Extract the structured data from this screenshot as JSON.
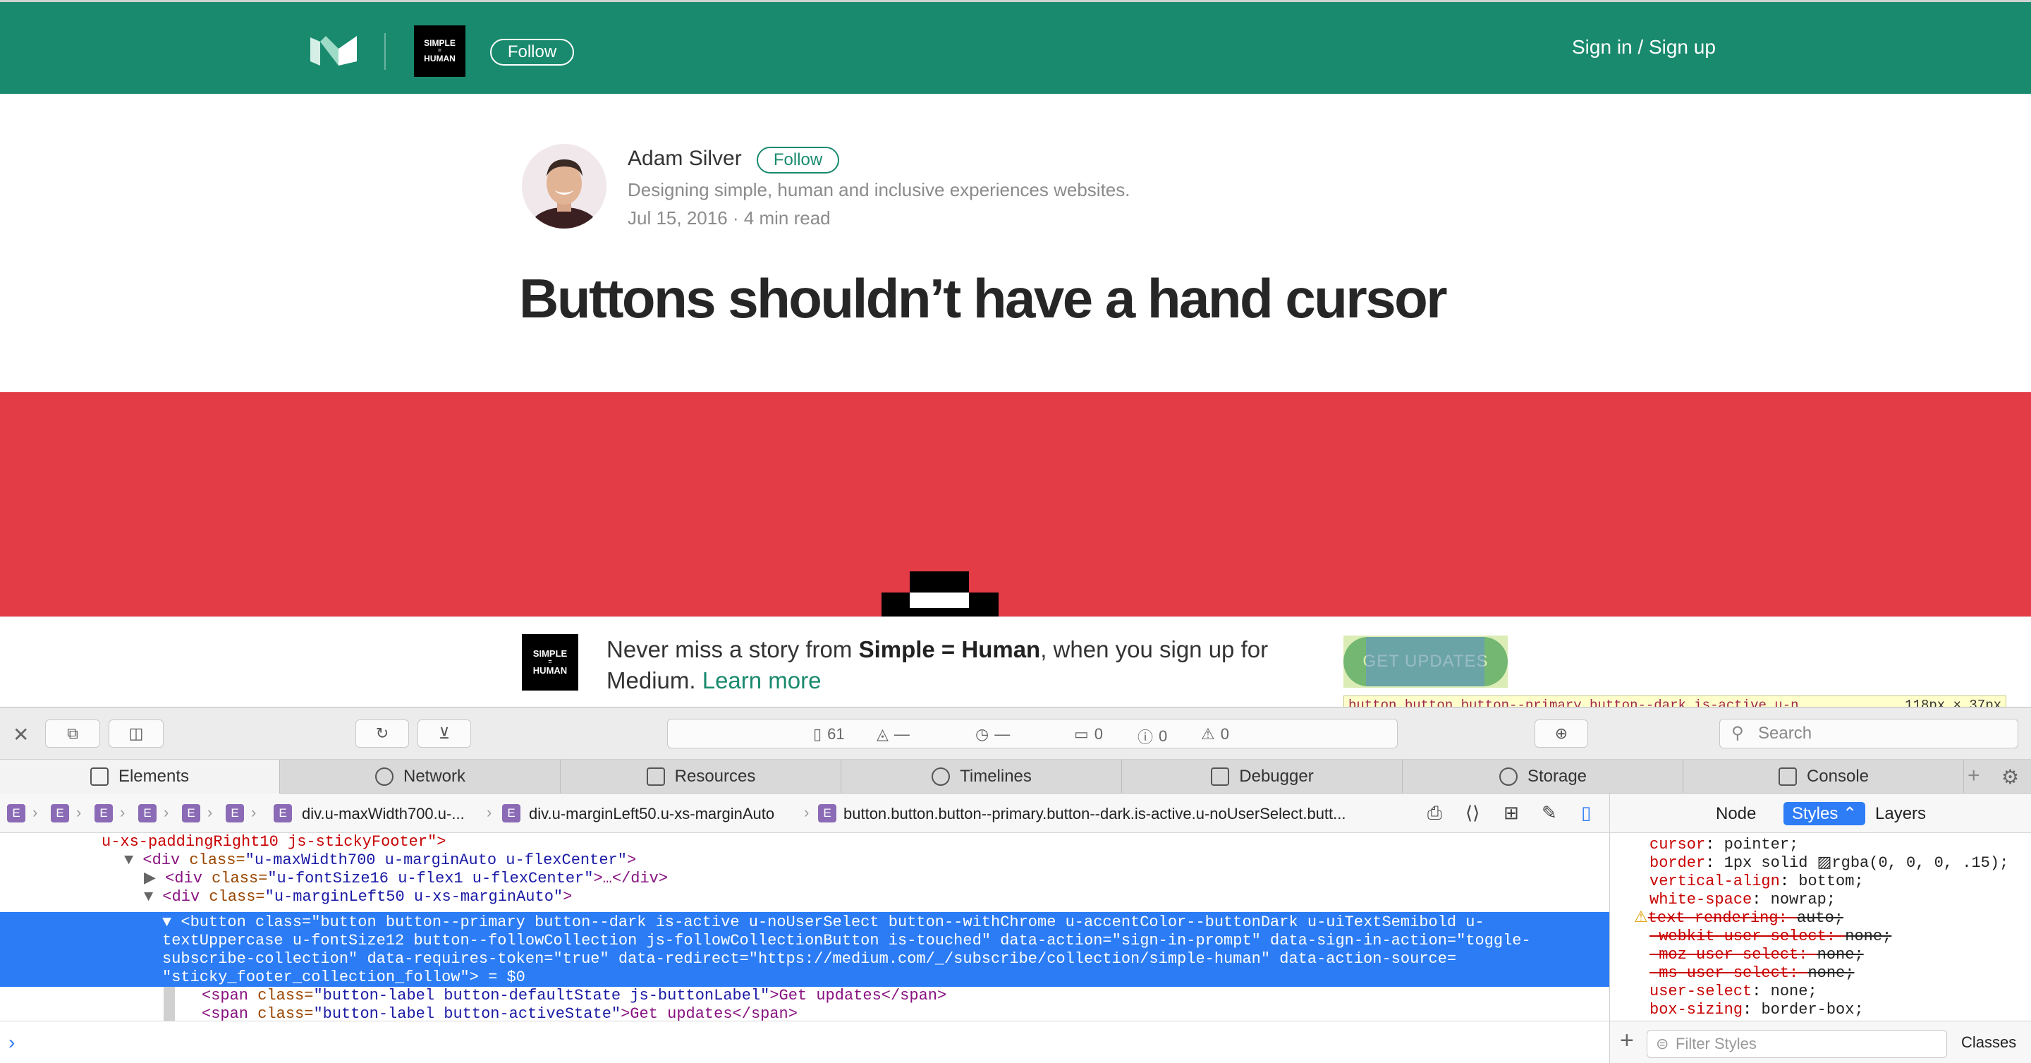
{
  "header": {
    "follow_label": "Follow",
    "signin_label": "Sign in / Sign up",
    "pub_logo_line1": "SIMPLE",
    "pub_logo_line2": "=",
    "pub_logo_line3": "HUMAN"
  },
  "author": {
    "name": "Adam Silver",
    "follow_label": "Follow",
    "bio": "Designing simple, human and inclusive experiences websites.",
    "meta": "Jul 15, 2016 · 4 min read"
  },
  "post": {
    "title": "Buttons shouldn’t have a hand cursor"
  },
  "sticky_footer": {
    "text_before": "Never miss a story from ",
    "pub_name": "Simple = Human",
    "text_after": ", when you sign up for Medium. ",
    "learn_more": "Learn more",
    "button_label": "Get updates",
    "pub_logo_line1": "SIMPLE",
    "pub_logo_line2": "=",
    "pub_logo_line3": "HUMAN"
  },
  "inspector_tooltip": {
    "selector": "button.button.button--primary.button--dark.is-active.u-n",
    "size": "118px × 37px"
  },
  "devtools": {
    "status": {
      "resources": "61",
      "logs": "0",
      "errors": "0",
      "warnings": "0",
      "dash": "—"
    },
    "search_placeholder": "Search",
    "tabs": [
      "Elements",
      "Network",
      "Resources",
      "Timelines",
      "Debugger",
      "Storage",
      "Console"
    ],
    "breadcrumbs": {
      "e": "E",
      "c1": "div.u-maxWidth700.u-...",
      "c2": "div.u-marginLeft50.u-xs-marginAuto",
      "c3": "button.button.button--primary.button--dark.is-active.u-noUserSelect.butt..."
    },
    "side_tabs": {
      "node": "Node",
      "styles": "Styles ⌃",
      "layers": "Layers"
    },
    "dom": {
      "l0": "u-xs-paddingRight10 js-stickyFooter\">",
      "l1_tag": "<div ",
      "l1_attr": "class=",
      "l1_val": "\"u-maxWidth700 u-marginAuto u-flexCenter\"",
      "l1_end": ">",
      "l2_tag": "<div ",
      "l2_attr": "class=",
      "l2_val": "\"u-fontSize16 u-flex1 u-flexCenter\"",
      "l2_end": ">…</div>",
      "l3_tag": "<div ",
      "l3_attr": "class=",
      "l3_val": "\"u-marginLeft50 u-xs-marginAuto\"",
      "l3_end": ">",
      "selected": "▼ <button class=\"button button--primary button--dark is-active u-noUserSelect button--withChrome u-accentColor--buttonDark u-uiTextSemibold u-\ntextUppercase u-fontSize12 button--followCollection js-followCollectionButton is-touched\" data-action=\"sign-in-prompt\" data-sign-in-action=\"toggle-\nsubscribe-collection\" data-requires-token=\"true\" data-redirect=\"https://medium.com/_/subscribe/collection/simple-human\" data-action-source=\n\"sticky_footer_collection_follow\"> = $0",
      "l5_tag": "<span ",
      "l5_attr": "class=",
      "l5_val": "\"button-label button-defaultState js-buttonLabel\"",
      "l5_text": ">Get updates</span>",
      "l6_tag": "<span ",
      "l6_attr": "class=",
      "l6_val": "\"button-label button-activeState\"",
      "l6_text": ">Get updates</span>"
    },
    "styles": [
      {
        "prop": "cursor",
        "val": "pointer;",
        "strike": false
      },
      {
        "prop": "border",
        "val": "1px solid ▨rgba(0, 0, 0, .15);",
        "strike": false
      },
      {
        "prop": "vertical-align",
        "val": "bottom;",
        "strike": false
      },
      {
        "prop": "white-space",
        "val": "nowrap;",
        "strike": false
      },
      {
        "prop": "text-rendering",
        "val": "auto;",
        "strike": true
      },
      {
        "prop": "-webkit-user-select",
        "val": "none;",
        "strike": true
      },
      {
        "prop": "-moz-user-select",
        "val": "none;",
        "strike": true
      },
      {
        "prop": "-ms-user-select",
        "val": "none;",
        "strike": true
      },
      {
        "prop": "user-select",
        "val": "none;",
        "strike": false
      },
      {
        "prop": "box-sizing",
        "val": "border-box;",
        "strike": false
      }
    ],
    "filter_placeholder": "Filter Styles",
    "classes_label": "Classes"
  },
  "colors": {
    "header_green": "#1a8a6e",
    "hero_red": "#e43c46",
    "selection_blue": "#2b7cf5"
  }
}
